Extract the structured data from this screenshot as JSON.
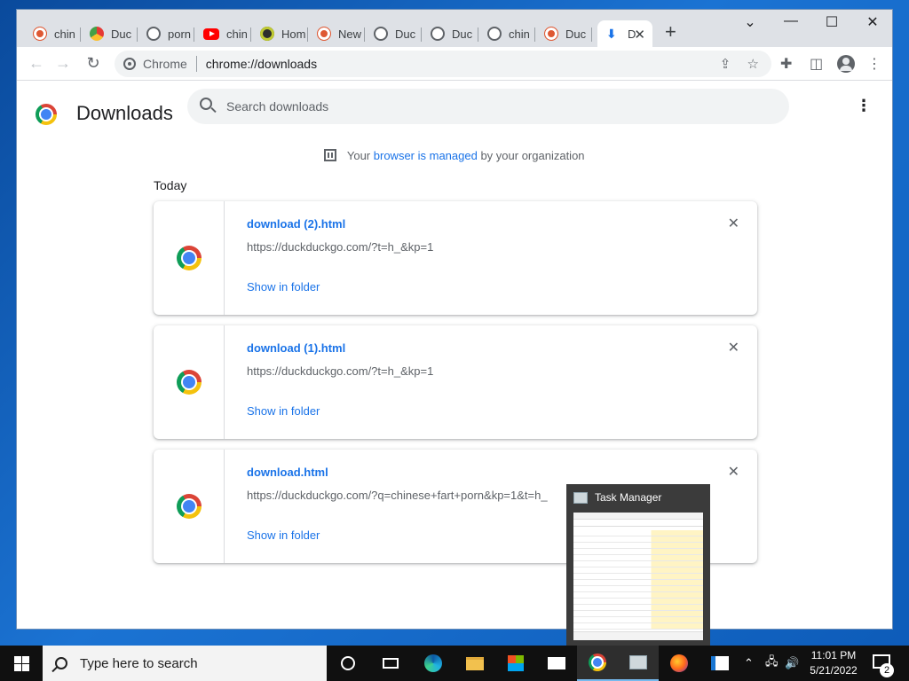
{
  "browser": {
    "tabs": [
      {
        "title": "chin",
        "favicon": "duckduckgo-icon"
      },
      {
        "title": "Duc",
        "favicon": "pinwheel-icon"
      },
      {
        "title": "porn",
        "favicon": "globe-icon"
      },
      {
        "title": "chin",
        "favicon": "youtube-icon"
      },
      {
        "title": "Hom",
        "favicon": "site-icon"
      },
      {
        "title": "New",
        "favicon": "duckduckgo-icon"
      },
      {
        "title": "Duc",
        "favicon": "globe-icon"
      },
      {
        "title": "Duc",
        "favicon": "globe-icon"
      },
      {
        "title": "chin",
        "favicon": "globe-icon"
      },
      {
        "title": "Duc",
        "favicon": "duckduckgo-icon"
      },
      {
        "title": "D",
        "favicon": "download-icon",
        "active": true
      }
    ],
    "omnibox": {
      "chip": "Chrome",
      "url": "chrome://downloads"
    }
  },
  "downloads": {
    "title": "Downloads",
    "search_placeholder": "Search downloads",
    "managed": {
      "prefix": "Your",
      "link": "browser is managed",
      "suffix": "by your organization"
    },
    "section": "Today",
    "items": [
      {
        "name": "download (2).html",
        "url": "https://duckduckgo.com/?t=h_&kp=1",
        "action": "Show in folder"
      },
      {
        "name": "download (1).html",
        "url": "https://duckduckgo.com/?t=h_&kp=1",
        "action": "Show in folder"
      },
      {
        "name": "download.html",
        "url": "https://duckduckgo.com/?q=chinese+fart+porn&kp=1&t=h_",
        "action": "Show in folder"
      }
    ]
  },
  "taskbar": {
    "search_placeholder": "Type here to search",
    "clock_time": "11:01 PM",
    "clock_date": "5/21/2022",
    "notification_count": "2",
    "preview_title": "Task Manager"
  },
  "colors": {
    "accent": "#1a73e8",
    "tabstrip": "#dee1e6",
    "taskbar": "#101010"
  }
}
